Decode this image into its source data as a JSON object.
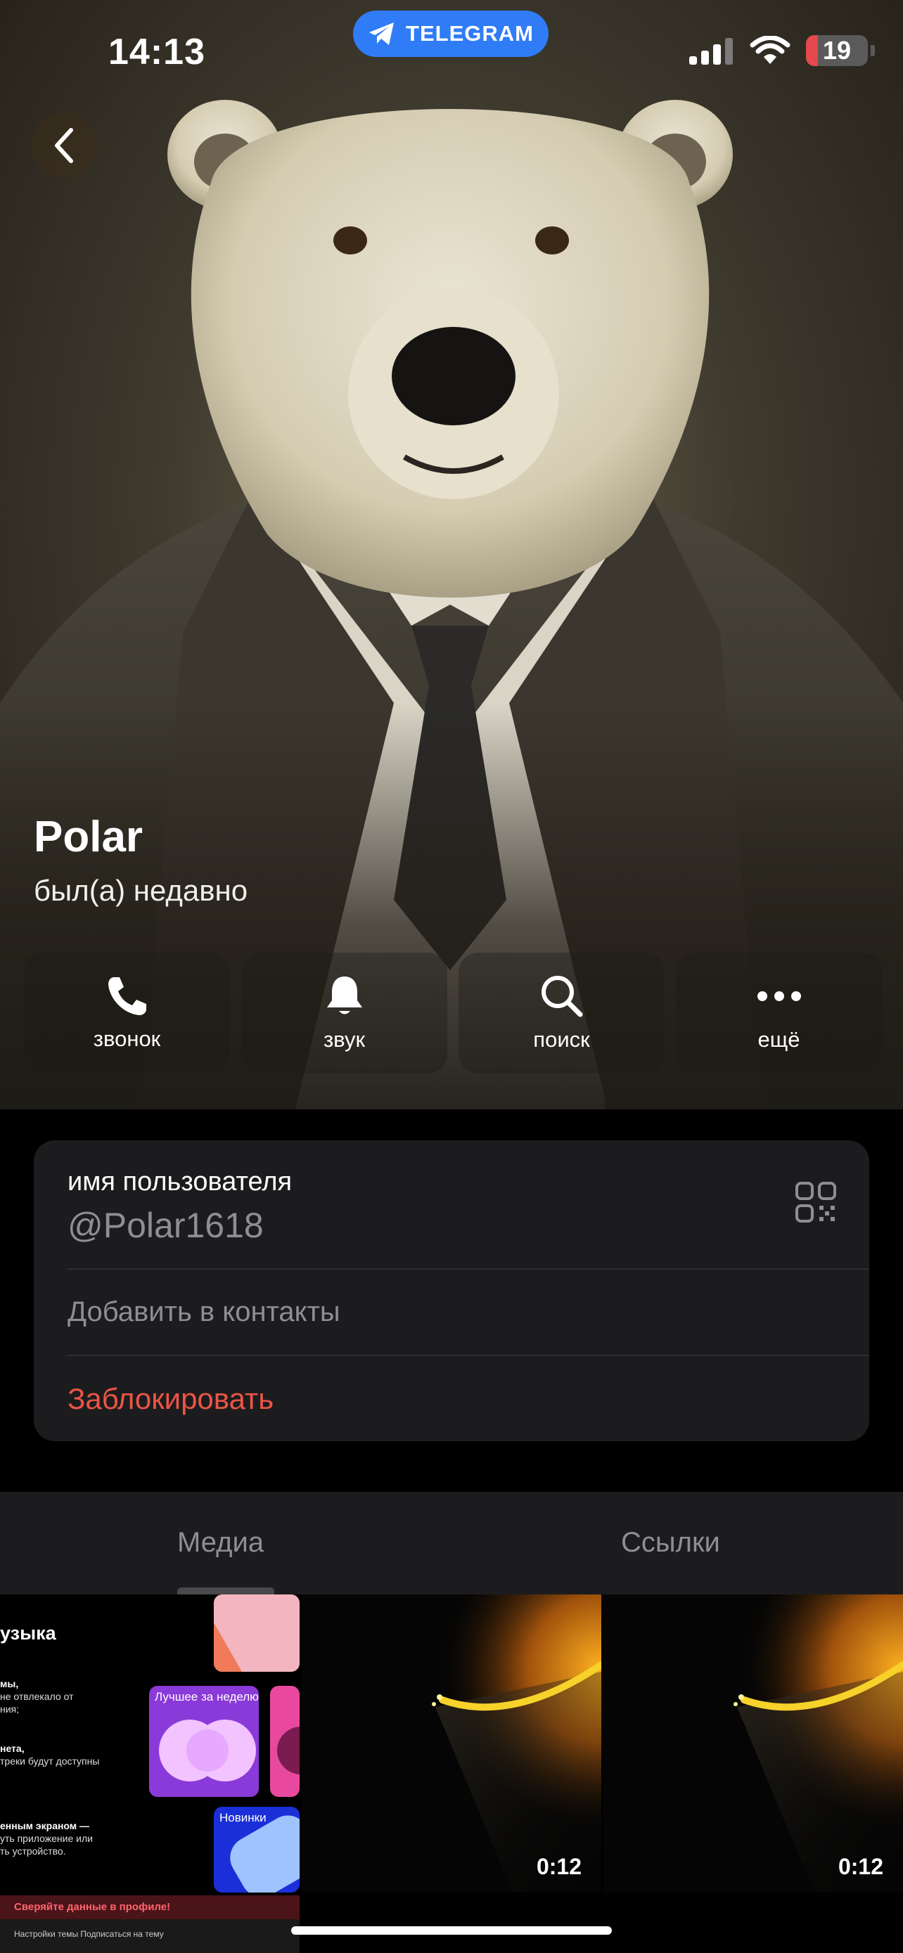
{
  "status_bar": {
    "time": "14:13",
    "app_pill": "TELEGRAM",
    "battery_level": "19",
    "battery_fraction": 0.19,
    "battery_color": "#e5484d"
  },
  "profile": {
    "name": "Polar",
    "status": "был(а) недавно"
  },
  "actions": [
    {
      "label": "звонок",
      "icon": "phone-icon"
    },
    {
      "label": "звук",
      "icon": "bell-icon"
    },
    {
      "label": "поиск",
      "icon": "search-icon"
    },
    {
      "label": "ещё",
      "icon": "more-icon"
    }
  ],
  "info": {
    "username_label": "имя пользователя",
    "username": "@Polar1618",
    "add_contact": "Добавить в контакты",
    "block": "Заблокировать",
    "block_color": "#eb5545"
  },
  "tabs": [
    {
      "label": "Медиа",
      "active": true
    },
    {
      "label": "Ссылки",
      "active": false
    }
  ],
  "media": {
    "screenshot": {
      "title": "узыка",
      "tile_best_week": "Лучшее за неделю",
      "tile_new": "Новинки",
      "line_a": "мы,",
      "line_b": "не отвлекало от",
      "line_c": "ния;",
      "line_d": "нета,",
      "line_e": "треки будут доступны",
      "line_f": "енным экраном —",
      "line_g": "уть приложение или",
      "line_h": "ть устройство.",
      "banner": "Сверяйте данные в профиле!",
      "footer": "Настройки темы   Подписаться на тему"
    },
    "videos": [
      {
        "duration": "0:12"
      },
      {
        "duration": "0:12"
      }
    ]
  },
  "colors": {
    "accent": "#2f7cf6",
    "card_bg": "#1c1c1e",
    "secondary_text": "#8e8e93"
  }
}
